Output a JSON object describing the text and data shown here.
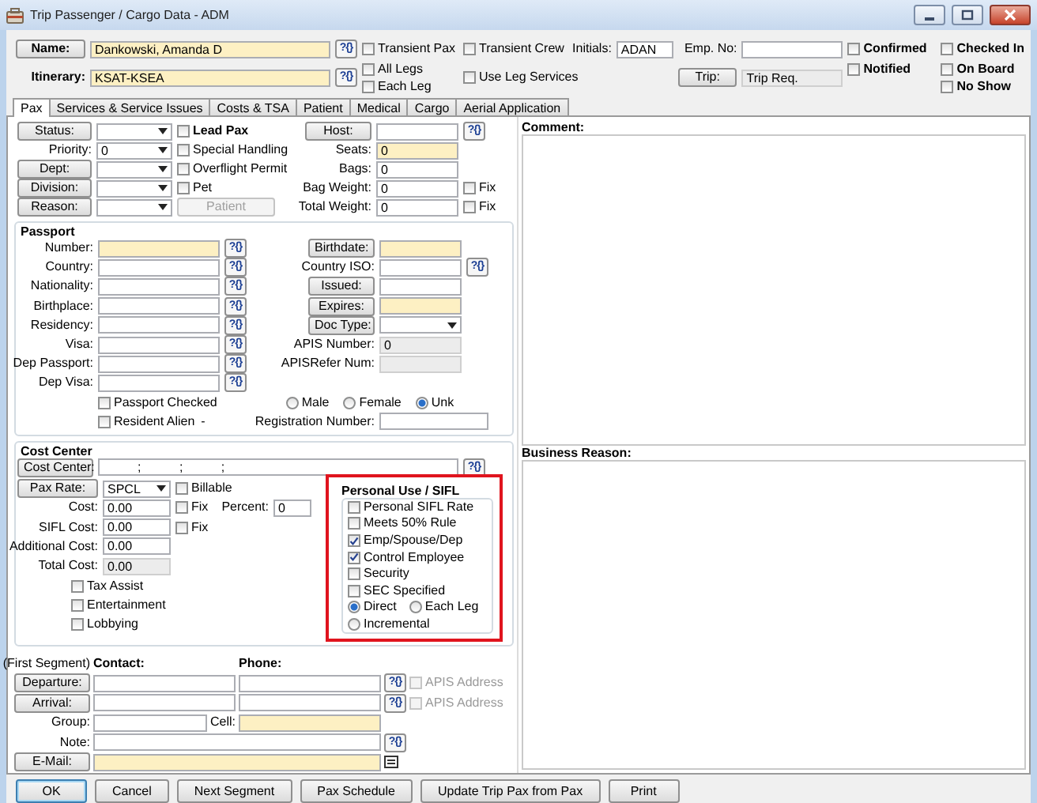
{
  "window": {
    "title": "Trip Passenger / Cargo Data - ADM"
  },
  "header": {
    "name": {
      "label": "Name:",
      "value": "Dankowski, Amanda D",
      "highlighted": true,
      "lookup": "?{}"
    },
    "itinerary": {
      "label": "Itinerary:",
      "value": "KSAT-KSEA",
      "highlighted": true,
      "lookup": "?{}"
    },
    "transient_pax": {
      "label": "Transient Pax",
      "checked": false
    },
    "all_legs": {
      "label": "All Legs",
      "checked": false
    },
    "each_leg": {
      "label": "Each Leg",
      "checked": false
    },
    "transient_crew": {
      "label": "Transient Crew",
      "checked": false
    },
    "use_leg_services": {
      "label": "Use Leg Services",
      "checked": false
    },
    "initials": {
      "label": "Initials:",
      "value": "ADAN"
    },
    "emp_no": {
      "label": "Emp. No:"
    },
    "trip": {
      "label": "Trip:",
      "value": "Trip Req.",
      "readonly": true
    },
    "confirmed": {
      "label": "Confirmed",
      "checked": false
    },
    "notified": {
      "label": "Notified",
      "checked": false
    },
    "checked_in": {
      "label": "Checked In",
      "checked": false
    },
    "on_board": {
      "label": "On Board",
      "checked": false
    },
    "no_show": {
      "label": "No Show",
      "checked": false
    }
  },
  "tabs": [
    {
      "label": "Pax",
      "selected": true
    },
    {
      "label": "Services & Service Issues",
      "selected": false
    },
    {
      "label": "Costs & TSA",
      "selected": false
    },
    {
      "label": "Patient",
      "selected": false
    },
    {
      "label": "Medical",
      "selected": false
    },
    {
      "label": "Cargo",
      "selected": false
    },
    {
      "label": "Aerial Application",
      "selected": false
    }
  ],
  "pax": {
    "status": {
      "label": "Status:"
    },
    "priority": {
      "label": "Priority:",
      "value": "0"
    },
    "dept": {
      "label": "Dept:"
    },
    "division": {
      "label": "Division:"
    },
    "reason": {
      "label": "Reason:"
    },
    "lead_pax": {
      "label": "Lead Pax",
      "checked": false
    },
    "special_handling": {
      "label": "Special Handling",
      "checked": false
    },
    "overflight_permit": {
      "label": "Overflight Permit",
      "checked": false
    },
    "pet": {
      "label": "Pet",
      "checked": false
    },
    "patient_button": {
      "label": "Patient",
      "disabled": true
    },
    "host": {
      "label": "Host:",
      "lookup": "?{}"
    },
    "seats": {
      "label": "Seats:",
      "value": "0",
      "highlighted": true
    },
    "bags": {
      "label": "Bags:",
      "value": "0"
    },
    "bag_weight": {
      "label": "Bag Weight:",
      "value": "0",
      "fix": {
        "label": "Fix",
        "checked": false
      }
    },
    "total_weight": {
      "label": "Total Weight:",
      "value": "0",
      "fix": {
        "label": "Fix",
        "checked": false
      }
    }
  },
  "passport": {
    "title": "Passport",
    "number": {
      "label": "Number:",
      "highlighted": true,
      "lookup": "?{}"
    },
    "country": {
      "label": "Country:",
      "lookup": "?{}"
    },
    "nationality": {
      "label": "Nationality:",
      "lookup": "?{}"
    },
    "birthplace": {
      "label": "Birthplace:",
      "lookup": "?{}"
    },
    "residency": {
      "label": "Residency:",
      "lookup": "?{}"
    },
    "visa": {
      "label": "Visa:",
      "lookup": "?{}"
    },
    "dep_passport": {
      "label": "Dep Passport:",
      "lookup": "?{}"
    },
    "dep_visa": {
      "label": "Dep Visa:",
      "lookup": "?{}"
    },
    "birthdate": {
      "label": "Birthdate:",
      "highlighted": true
    },
    "country_iso": {
      "label": "Country ISO:",
      "lookup": "?{}"
    },
    "issued": {
      "label": "Issued:"
    },
    "expires": {
      "label": "Expires:",
      "highlighted": true
    },
    "doc_type": {
      "label": "Doc Type:"
    },
    "apis_number": {
      "label": "APIS Number:",
      "value": "0",
      "readonly": true
    },
    "apis_refer_num": {
      "label": "APISRefer Num:",
      "readonly": true
    },
    "gender": [
      {
        "label": "Male",
        "selected": false
      },
      {
        "label": "Female",
        "selected": false
      },
      {
        "label": "Unk",
        "selected": true
      }
    ],
    "passport_checked": {
      "label": "Passport Checked",
      "checked": false
    },
    "resident_alien": {
      "label": "Resident Alien",
      "checked": false,
      "suffix": "-"
    },
    "registration_number": {
      "label": "Registration Number:"
    }
  },
  "cost_center": {
    "title": "Cost Center",
    "cost_center": {
      "label": "Cost Center:",
      "value": "; ; ;",
      "lookup": "?{}"
    },
    "pax_rate": {
      "label": "Pax Rate:",
      "value": "SPCL"
    },
    "billable": {
      "label": "Billable",
      "checked": false
    },
    "cost": {
      "label": "Cost:",
      "value": "0.00"
    },
    "cost_fix": {
      "label": "Fix",
      "checked": false
    },
    "percent": {
      "label": "Percent:",
      "value": "0"
    },
    "sifl_cost": {
      "label": "SIFL Cost:",
      "value": "0.00"
    },
    "sifl_fix": {
      "label": "Fix",
      "checked": false
    },
    "additional_cost": {
      "label": "Additional Cost:",
      "value": "0.00"
    },
    "total_cost": {
      "label": "Total Cost:",
      "value": "0.00",
      "readonly": true
    },
    "tax_assist": {
      "label": "Tax Assist",
      "checked": false
    },
    "entertainment": {
      "label": "Entertainment",
      "checked": false
    },
    "lobbying": {
      "label": "Lobbying",
      "checked": false
    },
    "personal_use": {
      "title": "Personal Use / SIFL",
      "checks": [
        {
          "label": "Personal SIFL Rate",
          "checked": false
        },
        {
          "label": "Meets 50% Rule",
          "checked": false
        },
        {
          "label": "Emp/Spouse/Dep",
          "checked": true
        },
        {
          "label": "Control Employee",
          "checked": true
        },
        {
          "label": "Security",
          "checked": false
        },
        {
          "label": "SEC Specified",
          "checked": false
        }
      ],
      "method": [
        {
          "label": "Direct",
          "selected": true
        },
        {
          "label": "Each Leg",
          "selected": false
        },
        {
          "label": "Incremental",
          "selected": false
        }
      ]
    }
  },
  "contact": {
    "segment": "(First Segment)",
    "contact_header": "Contact:",
    "phone_header": "Phone:",
    "departure": {
      "label": "Departure:",
      "lookup": "?{}",
      "apis": {
        "label": "APIS Address",
        "checked": false,
        "disabled": true
      }
    },
    "arrival": {
      "label": "Arrival:",
      "lookup": "?{}",
      "apis": {
        "label": "APIS Address",
        "checked": false,
        "disabled": true
      }
    },
    "group": {
      "label": "Group:"
    },
    "cell": {
      "label": "Cell:",
      "highlighted": true
    },
    "note": {
      "label": "Note:",
      "lookup": "?{}"
    },
    "email": {
      "label": "E-Mail:",
      "highlighted": true
    }
  },
  "comment": {
    "label": "Comment:"
  },
  "business_reason": {
    "label": "Business Reason:"
  },
  "buttons": [
    {
      "label": "OK",
      "focused": true
    },
    {
      "label": "Cancel",
      "focused": false
    },
    {
      "label": "Next Segment",
      "focused": false
    },
    {
      "label": "Pax Schedule",
      "focused": false
    },
    {
      "label": "Update Trip Pax from Pax",
      "focused": false
    },
    {
      "label": "Print",
      "focused": false
    }
  ]
}
